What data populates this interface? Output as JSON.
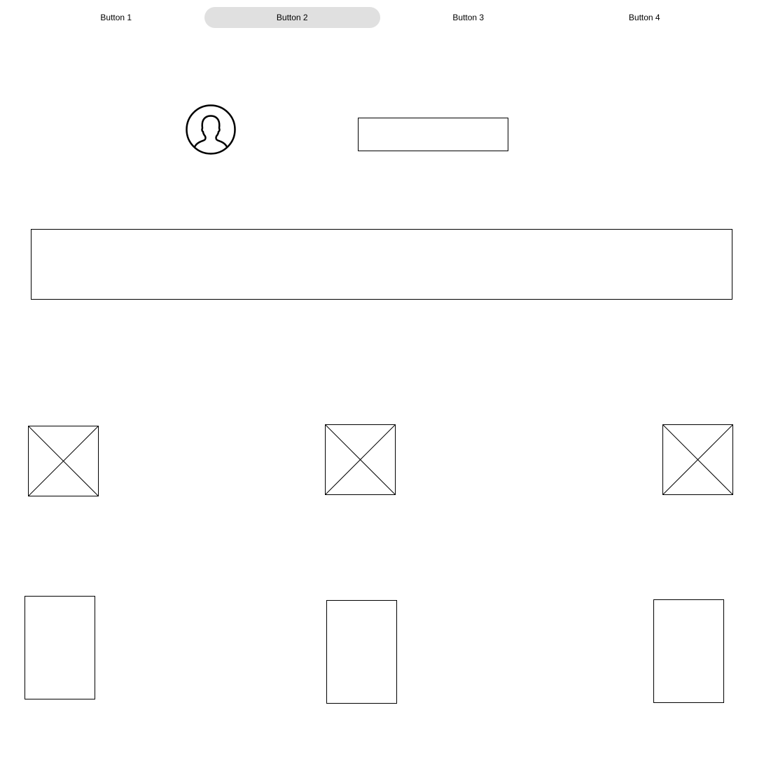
{
  "nav": {
    "buttons": [
      {
        "label": "Button 1",
        "active": false
      },
      {
        "label": "Button 2",
        "active": true
      },
      {
        "label": "Button 3",
        "active": false
      },
      {
        "label": "Button 4",
        "active": false
      }
    ]
  },
  "profile": {
    "avatar_icon": "user-silhouette-icon",
    "input_value": ""
  },
  "text_area": {
    "value": ""
  },
  "images": [
    {
      "icon": "image-placeholder-icon"
    },
    {
      "icon": "image-placeholder-icon"
    },
    {
      "icon": "image-placeholder-icon"
    }
  ],
  "cards": [
    {
      "content": ""
    },
    {
      "content": ""
    },
    {
      "content": ""
    }
  ],
  "colors": {
    "active_button_bg": "#e0e0e0",
    "stroke": "#000000",
    "background": "#ffffff"
  }
}
